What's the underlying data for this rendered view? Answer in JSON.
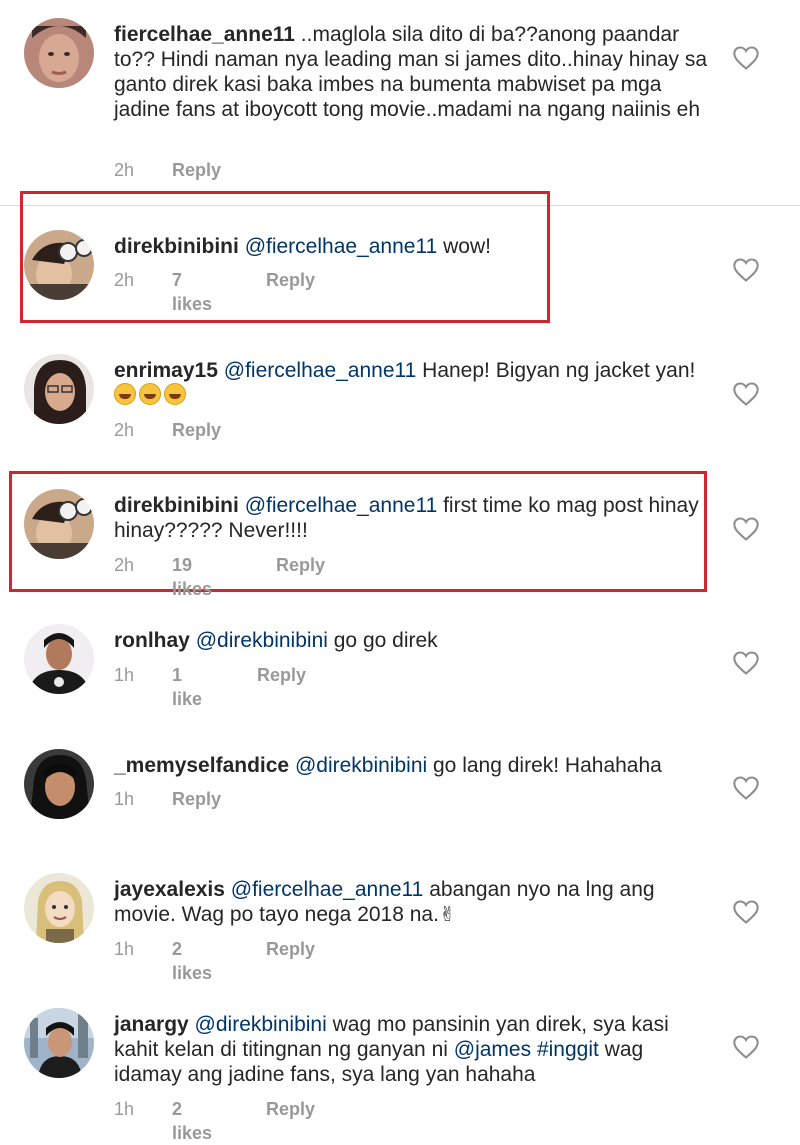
{
  "comments": [
    {
      "username": "fiercelhae_anne11",
      "mention": "",
      "text": " ..maglola sila dito di ba??anong paandar to?? Hindi naman nya leading man si james dito..hinay hinay sa ganto direk kasi baka imbes na bumenta mabwiset pa mga jadine fans at iboycott tong movie..madami na ngang naiinis eh",
      "time": "2h",
      "likes": "",
      "reply": "Reply"
    },
    {
      "username": "direkbinibini",
      "mention": "@fiercelhae_anne11",
      "text": " wow!",
      "time": "2h",
      "likes": "7 likes",
      "reply": "Reply"
    },
    {
      "username": "enrimay15",
      "mention": "@fiercelhae_anne11",
      "text": " Hanep! Bigyan ng jacket yan!",
      "emojis": [
        "grinning-sweat-emoji",
        "grinning-sweat-emoji",
        "grinning-sweat-emoji"
      ],
      "time": "2h",
      "likes": "",
      "reply": "Reply"
    },
    {
      "username": "direkbinibini",
      "mention": "@fiercelhae_anne11",
      "text": " first time ko mag post hinay hinay????? Never!!!!",
      "time": "2h",
      "likes": "19 likes",
      "reply": "Reply"
    },
    {
      "username": "ronlhay",
      "mention": "@direkbinibini",
      "text": " go go direk",
      "time": "1h",
      "likes": "1 like",
      "reply": "Reply"
    },
    {
      "username": "_memyselfandice",
      "mention": "@direkbinibini",
      "text": " go lang direk!  Hahahaha",
      "time": "1h",
      "likes": "",
      "reply": "Reply"
    },
    {
      "username": "jayexalexis",
      "mention": "@fiercelhae_anne11",
      "text": " abangan nyo na lng ang movie. Wag po tayo nega 2018 na.",
      "emojis": [
        "victory-hand-emoji"
      ],
      "time": "1h",
      "likes": "2 likes",
      "reply": "Reply"
    },
    {
      "username": "janargy",
      "mention": "@direkbinibini",
      "text_parts": [
        {
          "t": " wag mo pansinin yan direk, sya kasi kahit kelan di titingnan ng ganyan ni ",
          "m": false
        },
        {
          "t": "@james",
          "m": true
        },
        {
          "t": " ",
          "m": false
        },
        {
          "t": "#inggit",
          "m": true
        },
        {
          "t": " wag idamay ang jadine fans, sya lang yan hahaha",
          "m": false
        }
      ],
      "time": "1h",
      "likes": "2 likes",
      "reply": "Reply"
    }
  ],
  "colors": {
    "text": "#262626",
    "mention": "#003569",
    "meta": "#999999",
    "highlight": "#d0262f",
    "divider": "#dbdbdb"
  },
  "icons": {
    "like": "heart-outline-icon"
  }
}
